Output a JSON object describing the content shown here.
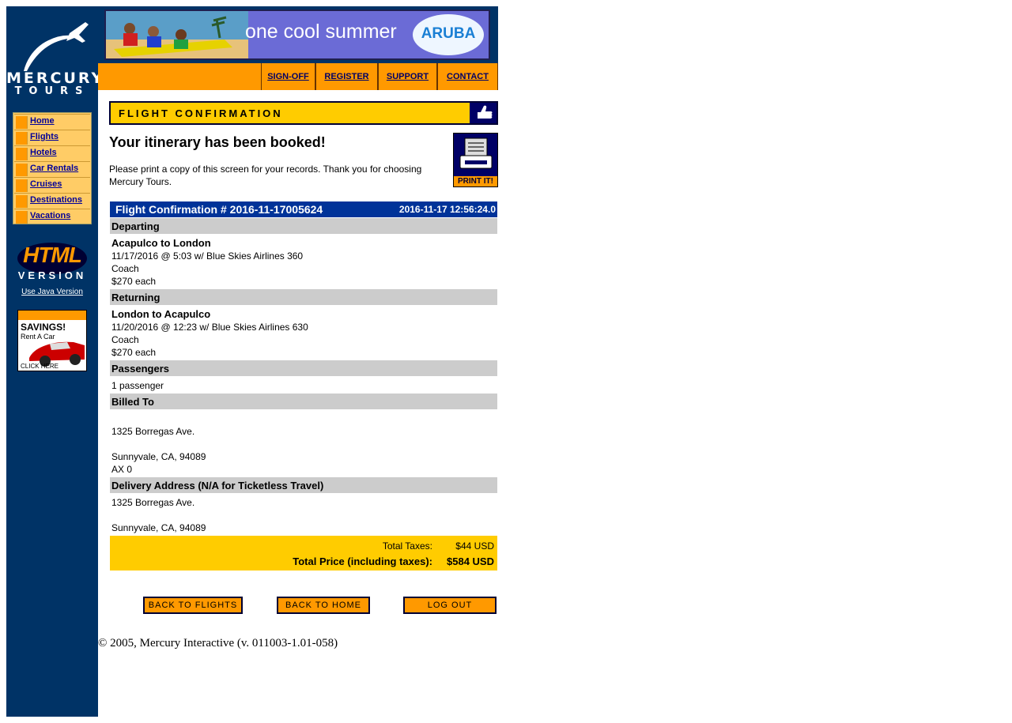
{
  "logo": {
    "line1": "MERCURY",
    "line2": "TOURS"
  },
  "sidebar": {
    "items": [
      {
        "label": "Home"
      },
      {
        "label": "Flights"
      },
      {
        "label": "Hotels"
      },
      {
        "label": "Car Rentals"
      },
      {
        "label": "Cruises"
      },
      {
        "label": "Destinations"
      },
      {
        "label": "Vacations"
      }
    ],
    "html_badge": {
      "line1": "HTML",
      "line2": "VERSION"
    },
    "java_link": "Use Java Version",
    "ad": {
      "headline": "SAVINGS!",
      "sub": "Rent A Car",
      "cta": "CLICK HERE"
    }
  },
  "banner": {
    "text": "one cool summer",
    "brand": "ARUBA"
  },
  "toolbar": {
    "signoff": "SIGN-OFF",
    "register": "REGISTER",
    "support": "SUPPORT",
    "contact": "CONTACT"
  },
  "page": {
    "title": "FLIGHT CONFIRMATION",
    "booked": "Your itinerary has been booked!",
    "print_note": "Please print a copy of this screen for your records. Thank you for choosing Mercury Tours.",
    "print_label": "PRINT IT!"
  },
  "confirmation": {
    "number": "Flight Confirmation # 2016-11-17005624",
    "datetime": "2016-11-17 12:56:24.0"
  },
  "departing": {
    "heading": "Departing",
    "route": "Acapulco to London",
    "details": "11/17/2016 @ 5:03 w/ Blue Skies Airlines 360",
    "class": "Coach",
    "price": "$270 each"
  },
  "returning": {
    "heading": "Returning",
    "route": "London to Acapulco",
    "details": "11/20/2016 @ 12:23 w/ Blue Skies Airlines 630",
    "class": "Coach",
    "price": "$270 each"
  },
  "passengers": {
    "heading": "Passengers",
    "count": "1 passenger"
  },
  "billed": {
    "heading": "Billed To",
    "street": "1325 Borregas Ave.",
    "city": "Sunnyvale, CA, 94089",
    "card": "AX 0"
  },
  "delivery": {
    "heading": "Delivery Address (N/A for Ticketless Travel)",
    "street": "1325 Borregas Ave.",
    "city": "Sunnyvale, CA, 94089"
  },
  "totals": {
    "tax_label": "Total Taxes:",
    "tax_value": "$44 USD",
    "total_label": "Total Price (including taxes):",
    "total_value": "$584 USD"
  },
  "buttons": {
    "back_flights": "BACK TO FLIGHTS",
    "back_home": "BACK TO HOME",
    "logout": "LOG OUT"
  },
  "footer": "© 2005, Mercury Interactive (v. 011003-1.01-058)",
  "colors": {
    "navy": "#003366",
    "orange": "#ff9900",
    "yellow": "#ffcc00",
    "blue_row": "#003399",
    "gray_row": "#cccccc"
  }
}
